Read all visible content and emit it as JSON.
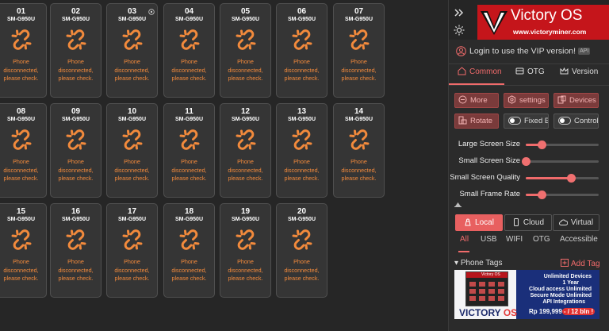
{
  "devices": [
    {
      "num": "01",
      "model": "SM-G950U"
    },
    {
      "num": "02",
      "model": "SM-G950U"
    },
    {
      "num": "03",
      "model": "SM-G950U"
    },
    {
      "num": "04",
      "model": "SM-G950U"
    },
    {
      "num": "05",
      "model": "SM-G950U"
    },
    {
      "num": "06",
      "model": "SM-G950U"
    },
    {
      "num": "07",
      "model": "SM-G950U"
    },
    {
      "num": "08",
      "model": "SM-G950U"
    },
    {
      "num": "09",
      "model": "SM-G950U"
    },
    {
      "num": "10",
      "model": "SM-G950U"
    },
    {
      "num": "11",
      "model": "SM-G950U"
    },
    {
      "num": "12",
      "model": "SM-G950U"
    },
    {
      "num": "13",
      "model": "SM-G950U"
    },
    {
      "num": "14",
      "model": "SM-G950U"
    },
    {
      "num": "15",
      "model": "SM-G950U"
    },
    {
      "num": "16",
      "model": "SM-G950U"
    },
    {
      "num": "17",
      "model": "SM-G950U"
    },
    {
      "num": "18",
      "model": "SM-G950U"
    },
    {
      "num": "19",
      "model": "SM-G950U"
    },
    {
      "num": "20",
      "model": "SM-G950U"
    }
  ],
  "device_status": [
    "Phone",
    "disconnected,",
    "please check."
  ],
  "colors": {
    "accent": "#f06b6b",
    "brand": "#c5151b",
    "disconnect": "#f28a3c"
  },
  "panel": {
    "brand_title": "Victory OS",
    "brand_url": "www.victoryminer.com",
    "login_text": "Login to use the VIP version!",
    "api_badge": "API",
    "tabs": [
      "Common",
      "OTG",
      "Version"
    ],
    "buttons": [
      "More",
      "settings",
      "Devices",
      "Rotate"
    ],
    "toggles": [
      "Fixed Big",
      "Control Sc"
    ],
    "sliders": [
      {
        "label": "Large Screen Size",
        "value": 0.22
      },
      {
        "label": "Small Screen Size",
        "value": 0.0
      },
      {
        "label": "Small Screen Quality",
        "value": 0.62
      },
      {
        "label": "Small Frame Rate",
        "value": 0.22
      }
    ],
    "connection_tabs": [
      "Local",
      "Cloud",
      "Virtual"
    ],
    "filter_tabs": [
      "All",
      "USB",
      "WIFI",
      "OTG",
      "Accessible"
    ],
    "phone_tags": "Phone Tags",
    "add_tag": "Add Tag"
  },
  "banner": {
    "line1": "Unlimited Devices",
    "line2": "1 Year",
    "line3": "Cloud access Unlimited",
    "line4": "Secure Mode Unlimited",
    "line5": "API Integrations",
    "price": "Rp 199,999",
    "price_suffix": "- / 12 bln !",
    "mini_title": "Victory OS",
    "brand_a": "VICTORY",
    "brand_b": "OS"
  }
}
